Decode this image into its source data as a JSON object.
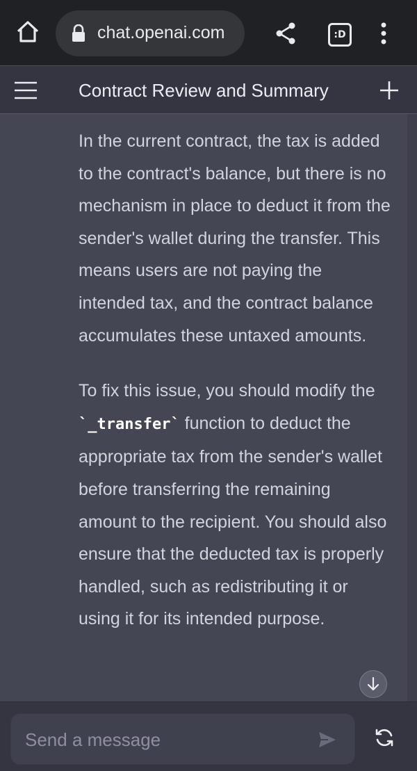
{
  "browser": {
    "url": "chat.openai.com",
    "tabs_count": ":D",
    "icons": [
      "home-icon",
      "lock-icon",
      "share-icon",
      "tabs-icon",
      "more-vert-icon"
    ]
  },
  "header": {
    "title": "Contract Review and Summary",
    "icons": [
      "menu-icon",
      "plus-icon"
    ]
  },
  "conversation": {
    "paragraph_1": "In the current contract, the tax is added to the contract's balance, but there is no mechanism in place to deduct it from the sender's wallet during the transfer. This means users are not paying the intended tax, and the contract balance accumulates these untaxed amounts.",
    "paragraph_2_before": "To fix this issue, you should modify the ",
    "paragraph_2_code": "`_transfer`",
    "paragraph_2_after": " function to deduct the appropriate tax from the sender's wallet before transferring the remaining amount to the recipient. You should also ensure that the deducted tax is properly handled, such as redistributing it or using it for its intended purpose."
  },
  "composer": {
    "placeholder": "Send a message",
    "icons": [
      "send-icon",
      "regenerate-icon",
      "arrow-down-icon"
    ]
  },
  "colors": {
    "chrome_bg": "#202124",
    "header_bg": "#343541",
    "message_bg": "#444654",
    "text": "#d1d5db"
  }
}
